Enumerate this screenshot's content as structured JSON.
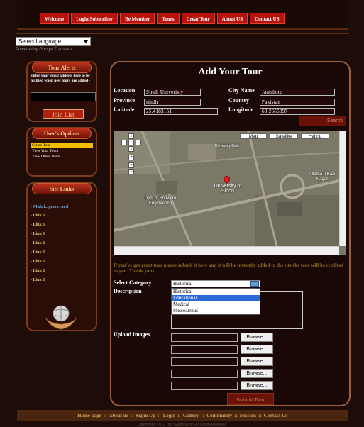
{
  "nav": [
    "Welcome",
    "Login Subscriber",
    "Be Member",
    "Tours",
    "Creat Tour",
    "About US",
    "Contact US"
  ],
  "language": {
    "selected": "Select Language",
    "powered_prefix": "Powered by",
    "powered_brand": "Google",
    "powered_suffix": "Translate"
  },
  "tour_alerts": {
    "title": "Tour Alerts",
    "text": "Enter your email address here to be notified when new tours are added -",
    "button": "Join List"
  },
  "user_options": {
    "title": "User's Options",
    "items": [
      "Create Tour",
      "View Your Tours",
      "View Other Tours"
    ]
  },
  "site_links": {
    "title": "Site Links",
    "items": [
      "- Mahli...geerzyard",
      "- Link 1",
      "- Link 1",
      "- Link 1",
      "- Link 1",
      "- Link 1",
      "- Link 1",
      "- Link 1",
      "- Link 1"
    ]
  },
  "form": {
    "title": "Add Your Tour",
    "location_label": "Location",
    "location_value": "Sindh Univeristy",
    "city_label": "City Name",
    "city_value": "Jamshoro",
    "province_label": "Province",
    "province_value": "sindh",
    "country_label": "Country",
    "country_value": "Pakistan",
    "latitude_label": "Latitude",
    "latitude_value": "25.4183151",
    "longitude_label": "Longitude",
    "longitude_value": "68.2666397",
    "search_button": "Search",
    "note": "If you've got great tour please submit it here and it will be instantly added to the site the tour will be credited to you. Thank yous",
    "category_label": "Select Category",
    "category_selected": "Historical",
    "category_options": [
      "Historical",
      "Educational",
      "Medical",
      "Miscealenus"
    ],
    "description_label": "Description",
    "upload_label": "Upload Images",
    "browse_label": "Browse...",
    "submit_button": "Submit Tour"
  },
  "map": {
    "type_buttons": [
      "Map",
      "Satellite",
      "Hybrid"
    ],
    "labels": {
      "university": "University of Sindh",
      "dept": "Dept of Software Engineering",
      "uni_gate": "University Gate",
      "alamill": "Allama II Kazi Nagar"
    }
  },
  "footer": [
    "Home page",
    "About us",
    "Sighn Up",
    "Login",
    "Gallery",
    "Community",
    "Mission",
    "Contact Us"
  ],
  "copyright": "Copyright © 2012 Tour Guide Sindh. All Rights Reserved"
}
